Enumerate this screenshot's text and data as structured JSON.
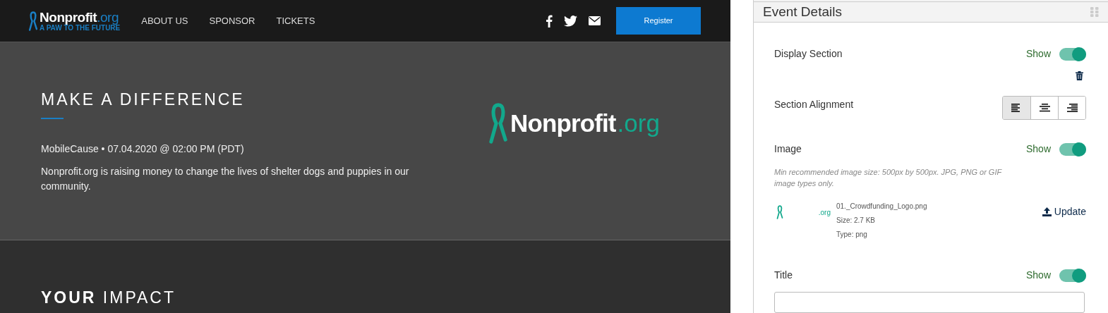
{
  "site": {
    "logo": {
      "name": "Nonprofit",
      "suffix": ".org",
      "tagline": "A PAW TO THE FUTURE"
    },
    "nav": [
      "ABOUT US",
      "SPONSOR",
      "TICKETS"
    ],
    "register": "Register",
    "hero": {
      "title": "MAKE A DIFFERENCE",
      "meta": "MobileCause • 07.04.2020 @ 02:00 PM (PDT)",
      "description": "Nonprofit.org is raising money to change the lives of shelter dogs and puppies in our community.",
      "logo_name": "Nonprofit",
      "logo_suffix": ".org"
    },
    "impact": {
      "bold": "YOUR",
      "rest": "IMPACT"
    }
  },
  "panel": {
    "title": "Event Details",
    "display_section": {
      "label": "Display Section",
      "state": "Show",
      "on": true
    },
    "alignment": {
      "label": "Section Alignment",
      "options": [
        {
          "kind": "left",
          "selected": true
        },
        {
          "kind": "center",
          "selected": false
        },
        {
          "kind": "right",
          "selected": false
        }
      ]
    },
    "image": {
      "label": "Image",
      "state": "Show",
      "on": true,
      "hint": "Min recommended image size: 500px by 500px. JPG, PNG or GIF image types only.",
      "thumb_suffix": ".org",
      "file_name": "01._Crowdfunding_Logo.png",
      "size": "Size: 2.7 KB",
      "type": "Type: png",
      "update": "Update"
    },
    "title_row": {
      "label": "Title",
      "state": "Show",
      "on": true
    }
  }
}
